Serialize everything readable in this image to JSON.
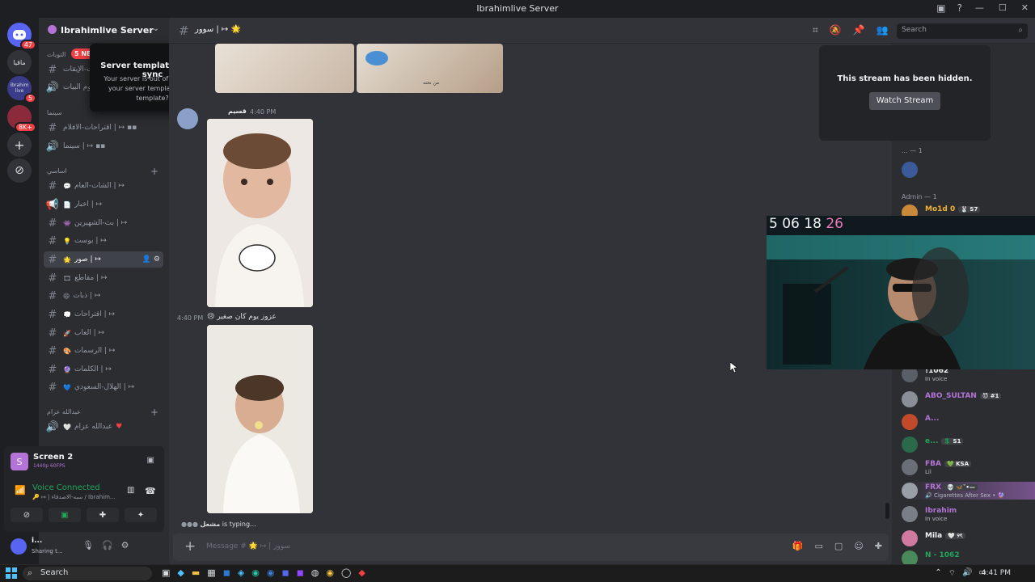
{
  "window": {
    "title": "Ibrahimlive Server",
    "controls": [
      "—",
      "☐",
      "✕"
    ]
  },
  "server_rail": {
    "home_badge": "47",
    "items": [
      {
        "label": "ماقيا",
        "badge": ""
      },
      {
        "label": "ibrahim live",
        "badge": "5"
      },
      {
        "label": "",
        "badge": "8K+"
      }
    ]
  },
  "server": {
    "name": "Ibrahimlive Server",
    "new_badge": "5 NE"
  },
  "popup": {
    "title": "Server template out of sync",
    "body": "Your server is out of sync with your server template. Sync template?"
  },
  "channels": {
    "categories": [
      {
        "label": "التوبات"
      },
      {
        "label": "سينما"
      },
      {
        "label": "اساسي"
      },
      {
        "label": "عبدالله عزام"
      }
    ],
    "items": [
      {
        "label": "القات-الإيقات",
        "emoji": "",
        "type": "text"
      },
      {
        "label": "روم البيات",
        "emoji": "",
        "type": "voice"
      },
      {
        "label": "اقتراحات-الافلام | ↦ ▪▪",
        "emoji": "",
        "type": "text"
      },
      {
        "label": "سينما | ↦ ▪▪",
        "emoji": "",
        "type": "voice"
      },
      {
        "label": "الشات-العام | ↦",
        "emoji": "💬",
        "type": "text"
      },
      {
        "label": "اخبار | ↦",
        "emoji": "📄",
        "type": "announce"
      },
      {
        "label": "بث-الشهيرين | ↦",
        "emoji": "👾",
        "type": "text"
      },
      {
        "label": "بوست | ↦",
        "emoji": "💡",
        "type": "text"
      },
      {
        "label": "صور | ↦",
        "emoji": "🌟",
        "type": "text"
      },
      {
        "label": "مقاطع | ↦",
        "emoji": "🎞",
        "type": "text"
      },
      {
        "label": "ذبات | ↦",
        "emoji": "😄",
        "type": "text"
      },
      {
        "label": "اقتراحات | ↦",
        "emoji": "💭",
        "type": "text"
      },
      {
        "label": "العاب | ↦",
        "emoji": "🚀",
        "type": "text"
      },
      {
        "label": "الرسمات | ↦",
        "emoji": "🎨",
        "type": "text"
      },
      {
        "label": "الكلمات | ↦",
        "emoji": "🔮",
        "type": "text"
      },
      {
        "label": "الهلال-السعودي | ↦",
        "emoji": "💙",
        "type": "text"
      },
      {
        "label": "عبدالله عزام",
        "emoji": "🤍",
        "type": "voice"
      }
    ]
  },
  "voice_panel": {
    "stream_title": "Screen 2",
    "stream_quality": "1440p 60FPS",
    "status": "Voice Connected",
    "location": "🔑 ↦ | سبه-الاصدقاء / Ibrahim..."
  },
  "user": {
    "name": "i...",
    "status": "Sharing t..."
  },
  "chat_header": {
    "channel": "سوور | ↦ 🌟",
    "search_placeholder": "Search"
  },
  "messages": [
    {
      "author": "قسيم",
      "timestamp": "4:40 PM",
      "text": ""
    },
    {
      "author": "",
      "timestamp": "4:40 PM",
      "text": "😢 عزوز يوم كان صغير"
    }
  ],
  "image_caption": "من نحته",
  "typing": {
    "name": "مشعل",
    "text": " is typing..."
  },
  "composer": {
    "placeholder": "Message # 🌟 ↦ | سوور"
  },
  "stream": {
    "message": "This stream has been hidden.",
    "button": "Watch Stream"
  },
  "members": {
    "groups": [
      {
        "label": "... — 1"
      },
      {
        "label": "Admin — 1"
      }
    ],
    "items": [
      {
        "name": "Mo1d 0",
        "tag": "🐰 S7",
        "sub": "",
        "color": "#f0b232"
      },
      {
        "name": "!1062",
        "tag": "",
        "sub": "In voice",
        "color": "#f2f3f5"
      },
      {
        "name": "ABO_SULTAN",
        "tag": "😈 #1",
        "sub": "",
        "color": "#b473d6"
      },
      {
        "name": "A...",
        "tag": "",
        "sub": "",
        "color": "#b473d6"
      },
      {
        "name": "e...",
        "tag": "💲 S1",
        "sub": "",
        "color": "#23a55a"
      },
      {
        "name": "FBA",
        "tag": "💚 KSA",
        "sub": "Lil",
        "color": "#b473d6"
      },
      {
        "name": "FRX",
        "tag": "💀 🦋ˇ•—",
        "sub": "🔊 Cigarettes After Sex • 🔮",
        "color": "#b473d6"
      },
      {
        "name": "Ibrahim",
        "tag": "",
        "sub": "In voice",
        "color": "#b473d6"
      },
      {
        "name": "Mila",
        "tag": "🤍 ୨ৎ",
        "sub": "",
        "color": "#f2f3f5"
      },
      {
        "name": "N - 1062",
        "tag": "",
        "sub": "",
        "color": "#23a55a"
      }
    ]
  },
  "camera": {
    "days": "5",
    "hours": "06",
    "minutes": "18",
    "seconds": "26"
  },
  "taskbar": {
    "search": "Search",
    "time": "4:41 PM"
  }
}
